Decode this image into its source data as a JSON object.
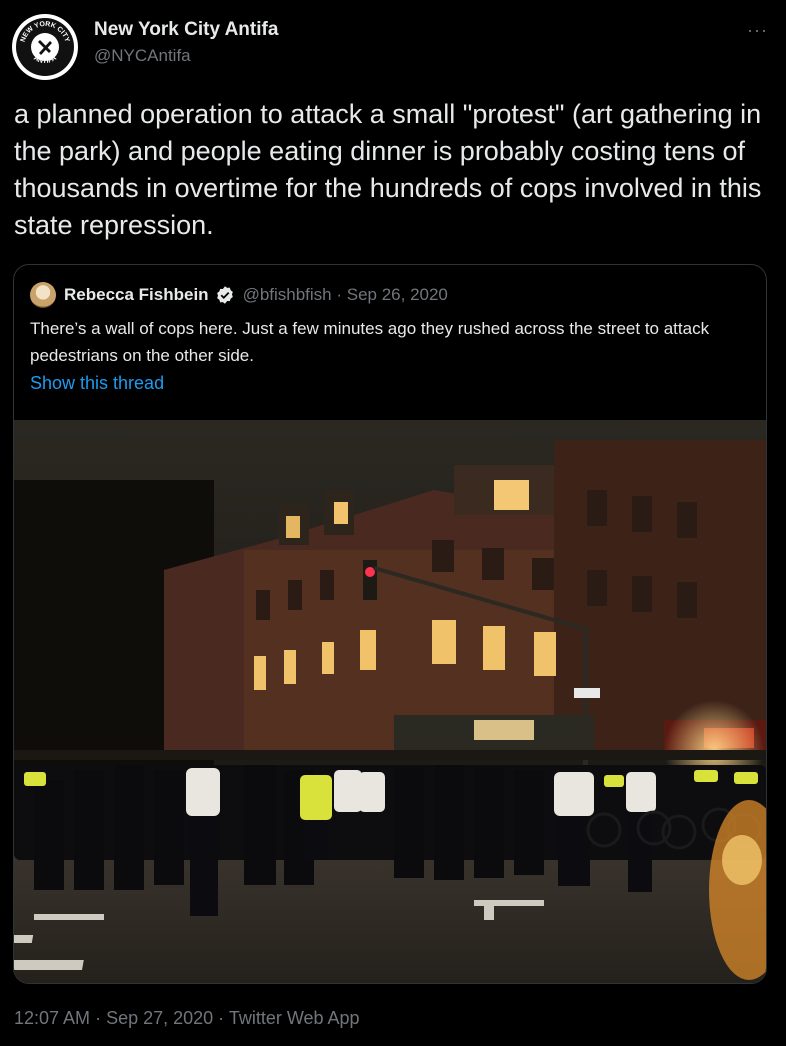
{
  "tweet": {
    "author_name": "New York City Antifa",
    "author_handle": "@NYCAntifa",
    "more_label": "···",
    "text": "a planned operation to attack a small \"protest\" (art gathering in the park) and people eating dinner is probably costing tens of thousands in overtime for the hundreds of cops involved in this state repression.",
    "avatar_ring_top": "NEW YORK CITY",
    "avatar_ring_bottom": "ANTIFA",
    "footer": {
      "time": "12:07 AM",
      "sep1": " · ",
      "date": "Sep 27, 2020",
      "sep2": " · ",
      "source": "Twitter Web App"
    }
  },
  "quoted": {
    "author_name": "Rebecca Fishbein",
    "meta": "@bfishbfish · Sep 26, 2020",
    "text": "There’s a wall of cops here. Just a few minutes ago they rushed across the street to attack pedestrians on the other side.",
    "show_thread": "Show this thread",
    "verified": true
  },
  "colors": {
    "background": "#000000",
    "text": "#e7e9ea",
    "secondary": "#71767b",
    "link": "#1d9bf0",
    "border": "#2f3336"
  }
}
